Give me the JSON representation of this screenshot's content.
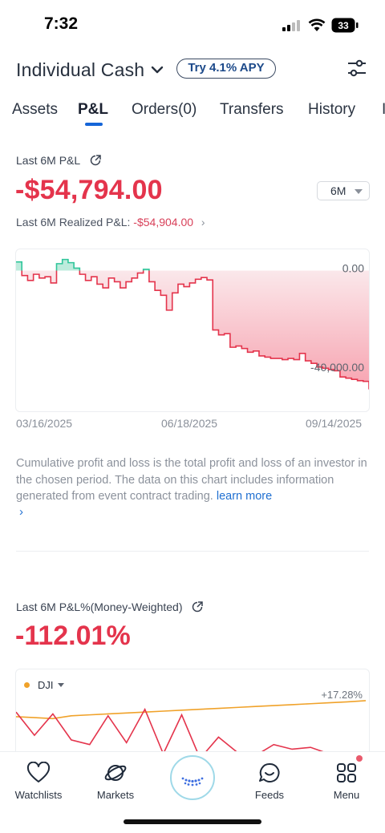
{
  "status_bar": {
    "time": "7:32",
    "battery": "33"
  },
  "header": {
    "account_title": "Individual Cash",
    "apy_label": "Try 4.1% APY"
  },
  "tabs": [
    {
      "label": "Assets"
    },
    {
      "label": "P&L"
    },
    {
      "label": "Orders(0)"
    },
    {
      "label": "Transfers"
    },
    {
      "label": "History"
    },
    {
      "label": "I"
    }
  ],
  "active_tab": "P&L",
  "pnl": {
    "label": "Last 6M P&L",
    "value": "-$54,794.00",
    "period": "6M",
    "realized_label": "Last 6M Realized P&L:",
    "realized_value": "-$54,904.00",
    "colors": {
      "loss": "#e4344c",
      "gain": "#2fc59a"
    }
  },
  "chart_data": {
    "type": "area",
    "x_ticks": [
      "03/16/2025",
      "06/18/2025",
      "09/14/2025"
    ],
    "y_ticks": [
      "0.00",
      "-40,000.00"
    ],
    "ylim": [
      -53000,
      6000
    ],
    "series": [
      {
        "values": [
          3500,
          -2000,
          -4000,
          -1500,
          -3000,
          -2500,
          -5000,
          2800,
          4500,
          3200,
          1000,
          -1500,
          -4000,
          -2500,
          -5500,
          -7000,
          -3000,
          -4500,
          -7000,
          -4500,
          -3000,
          -1000,
          500,
          -4500,
          -8000,
          -10000,
          -16000,
          -9000,
          -5500,
          -6500,
          -5000,
          -3500,
          -2800,
          -3800,
          -24000,
          -26000,
          -25500,
          -31000,
          -30500,
          -31500,
          -33000,
          -32500,
          -34500,
          -35000,
          -35500,
          -35500,
          -36000,
          -35500,
          -36000,
          -33500,
          -36500,
          -37500,
          -39000,
          -39500,
          -40000,
          -40500,
          -43000,
          -43500,
          -44000,
          -44500,
          -44800,
          -48000
        ]
      }
    ]
  },
  "description": {
    "text": "Cumulative profit and loss is the total profit and loss of an investor in the chosen period. The data on this chart includes information generated from event contract trading.",
    "link": "learn more",
    "chevron": "›"
  },
  "pnl_pct": {
    "label": "Last 6M P&L%(Money-Weighted)",
    "value": "-112.01%"
  },
  "chart_data_2": {
    "type": "line",
    "benchmark_label": "DJI",
    "benchmark_end": "+17.28%",
    "series": [
      {
        "color": "#f0a22a",
        "values": [
          0,
          -1,
          -2,
          1,
          2,
          3,
          4,
          5,
          6,
          7,
          8,
          9,
          10,
          11,
          12,
          13,
          14,
          15,
          16,
          17.28
        ]
      },
      {
        "color": "#e4344c",
        "values": [
          5,
          -20,
          3,
          -25,
          -30,
          1,
          -28,
          8,
          -40,
          2,
          -45,
          -22,
          -38,
          -42,
          -30,
          -35,
          -33,
          -40,
          -55,
          -60
        ]
      }
    ]
  },
  "bottom_nav": [
    {
      "label": "Watchlists",
      "icon": "heart-icon"
    },
    {
      "label": "Markets",
      "icon": "planet-icon"
    },
    {
      "label": "",
      "icon": "moomoo-center-icon"
    },
    {
      "label": "Feeds",
      "icon": "chat-bubble-icon"
    },
    {
      "label": "Menu",
      "icon": "grid-icon"
    }
  ]
}
